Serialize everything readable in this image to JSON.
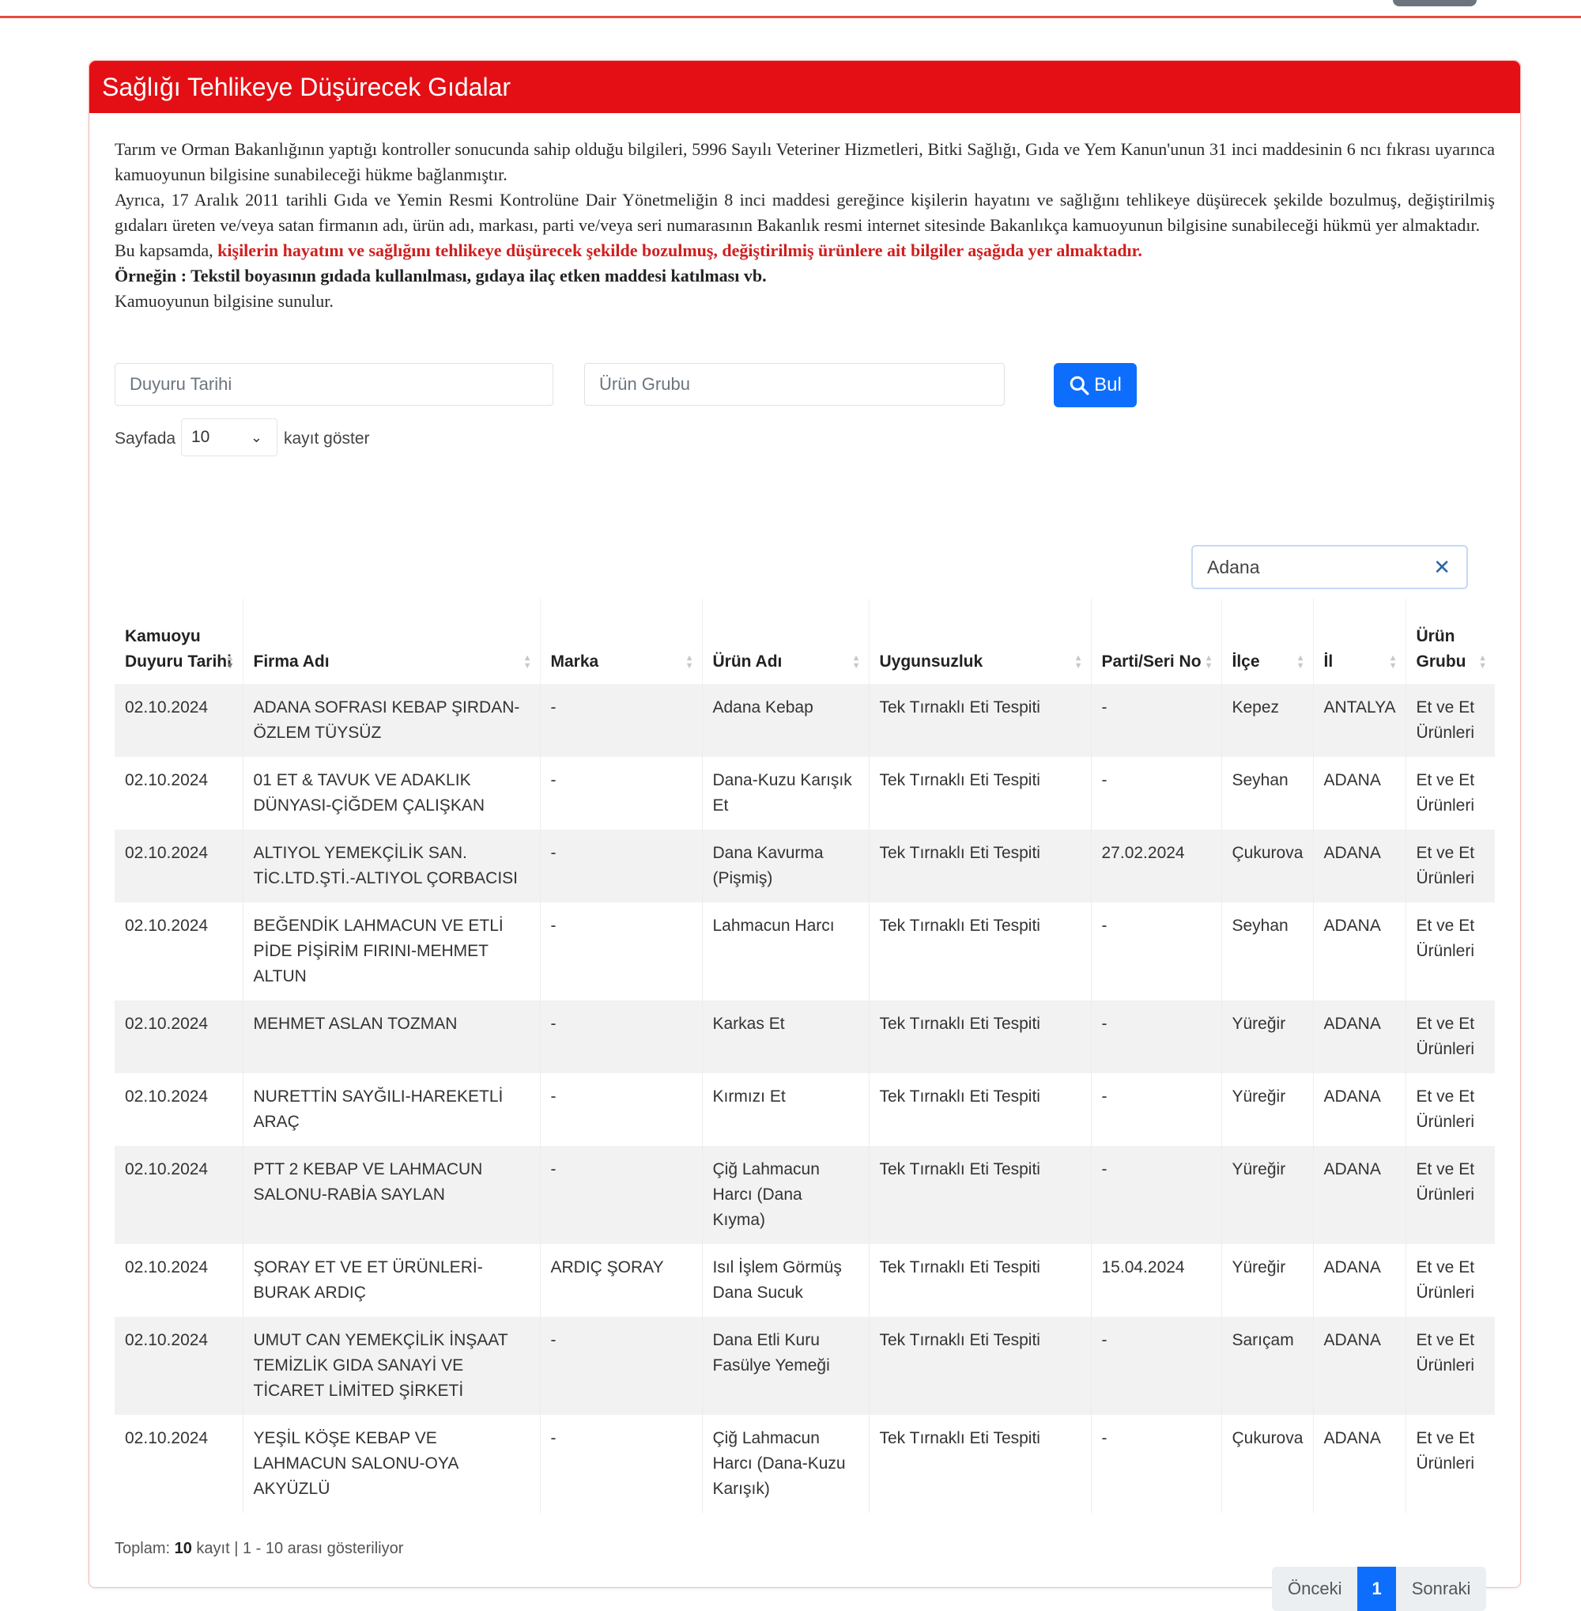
{
  "card_title": "Sağlığı Tehlikeye Düşürecek Gıdalar",
  "intro": {
    "p1": "Tarım ve Orman Bakanlığının yaptığı kontroller sonucunda sahip olduğu bilgileri, 5996 Sayılı Veteriner Hizmetleri, Bitki Sağlığı, Gıda ve Yem Kanun'unun 31 inci maddesinin 6 ncı fıkrası uyarınca kamuoyunun bilgisine sunabileceği hükme bağlanmıştır.",
    "p2": "Ayrıca, 17 Aralık 2011 tarihli Gıda ve Yemin Resmi Kontrolüne Dair Yönetmeliğin 8 inci maddesi gereğince kişilerin hayatını ve sağlığını tehlikeye düşürecek şekilde bozulmuş, değiştirilmiş gıdaları üreten ve/veya satan firmanın adı, ürün adı, markası, parti ve/veya seri numarasının Bakanlık resmi internet sitesinde Bakanlıkça kamuoyunun bilgisine sunabileceği hükmü yer almaktadır.",
    "p3_prefix": "Bu kapsamda, ",
    "p3_highlight": "kişilerin hayatını ve sağlığını tehlikeye düşürecek şekilde bozulmuş, değiştirilmiş ürünlere ait bilgiler aşağıda yer almaktadır.",
    "p4": "Örneğin : Tekstil boyasının gıdada kullanılması, gıdaya ilaç etken maddesi katılması vb.",
    "p5": "Kamuoyunun bilgisine sunulur."
  },
  "filters": {
    "date_placeholder": "Duyuru Tarihi",
    "group_placeholder": "Ürün Grubu",
    "search_button": "Bul",
    "search_icon": "magnifier-icon"
  },
  "perpage": {
    "label_before": "Sayfada",
    "value": "10",
    "label_after": "kayıt göster"
  },
  "table_search": {
    "value": "Adana",
    "clear_icon": "close-icon"
  },
  "columns": [
    "Kamuoyu Duyuru Tarihi",
    "Firma Adı",
    "Marka",
    "Ürün Adı",
    "Uygunsuzluk",
    "Parti/Seri No",
    "İlçe",
    "İl",
    "Ürün Grubu"
  ],
  "rows": [
    [
      "02.10.2024",
      "ADANA SOFRASI KEBAP ŞIRDAN-ÖZLEM TÜYSÜZ",
      "-",
      "Adana Kebap",
      "Tek Tırnaklı Eti Tespiti",
      "-",
      "Kepez",
      "ANTALYA",
      "Et ve Et Ürünleri"
    ],
    [
      "02.10.2024",
      "01 ET & TAVUK VE ADAKLIK DÜNYASI-ÇİĞDEM ÇALIŞKAN",
      "-",
      "Dana-Kuzu Karışık Et",
      "Tek Tırnaklı Eti Tespiti",
      "-",
      "Seyhan",
      "ADANA",
      "Et ve Et Ürünleri"
    ],
    [
      "02.10.2024",
      "ALTIYOL YEMEKÇİLİK SAN. TİC.LTD.ŞTİ.-ALTIYOL ÇORBACISI",
      "-",
      "Dana Kavurma (Pişmiş)",
      "Tek Tırnaklı Eti Tespiti",
      "27.02.2024",
      "Çukurova",
      "ADANA",
      "Et ve Et Ürünleri"
    ],
    [
      "02.10.2024",
      "BEĞENDİK LAHMACUN VE ETLİ PİDE PİŞİRİM FIRINI-MEHMET ALTUN",
      "-",
      "Lahmacun Harcı",
      "Tek Tırnaklı Eti Tespiti",
      "-",
      "Seyhan",
      "ADANA",
      "Et ve Et Ürünleri"
    ],
    [
      "02.10.2024",
      "MEHMET ASLAN TOZMAN",
      "-",
      "Karkas Et",
      "Tek Tırnaklı Eti Tespiti",
      "-",
      "Yüreğir",
      "ADANA",
      "Et ve Et Ürünleri"
    ],
    [
      "02.10.2024",
      "NURETTİN SAYĞILI-HAREKETLİ ARAÇ",
      "-",
      "Kırmızı Et",
      "Tek Tırnaklı Eti Tespiti",
      "-",
      "Yüreğir",
      "ADANA",
      "Et ve Et Ürünleri"
    ],
    [
      "02.10.2024",
      "PTT 2 KEBAP VE LAHMACUN SALONU-RABİA SAYLAN",
      "-",
      "Çiğ Lahmacun Harcı (Dana Kıyma)",
      "Tek Tırnaklı Eti Tespiti",
      "-",
      "Yüreğir",
      "ADANA",
      "Et ve Et Ürünleri"
    ],
    [
      "02.10.2024",
      "ŞORAY ET VE ET ÜRÜNLERİ-BURAK ARDIÇ",
      "ARDIÇ ŞORAY",
      "Isıl İşlem Görmüş Dana Sucuk",
      "Tek Tırnaklı Eti Tespiti",
      "15.04.2024",
      "Yüreğir",
      "ADANA",
      "Et ve Et Ürünleri"
    ],
    [
      "02.10.2024",
      "UMUT CAN YEMEKÇİLİK İNŞAAT TEMİZLİK GIDA SANAYİ VE TİCARET LİMİTED ŞİRKETİ",
      "-",
      "Dana Etli Kuru Fasülye Yemeği",
      "Tek Tırnaklı Eti Tespiti",
      "-",
      "Sarıçam",
      "ADANA",
      "Et ve Et Ürünleri"
    ],
    [
      "02.10.2024",
      "YEŞİL KÖŞE KEBAP VE LAHMACUN SALONU-OYA AKYÜZLÜ",
      "-",
      "Çiğ Lahmacun Harcı (Dana-Kuzu Karışık)",
      "Tek Tırnaklı Eti Tespiti",
      "-",
      "Çukurova",
      "ADANA",
      "Et ve Et Ürünleri"
    ]
  ],
  "summary": {
    "prefix": "Toplam: ",
    "count": "10",
    "suffix": " kayıt | 1 - 10 arası gösteriliyor"
  },
  "pagination": {
    "prev": "Önceki",
    "current": "1",
    "next": "Sonraki"
  }
}
